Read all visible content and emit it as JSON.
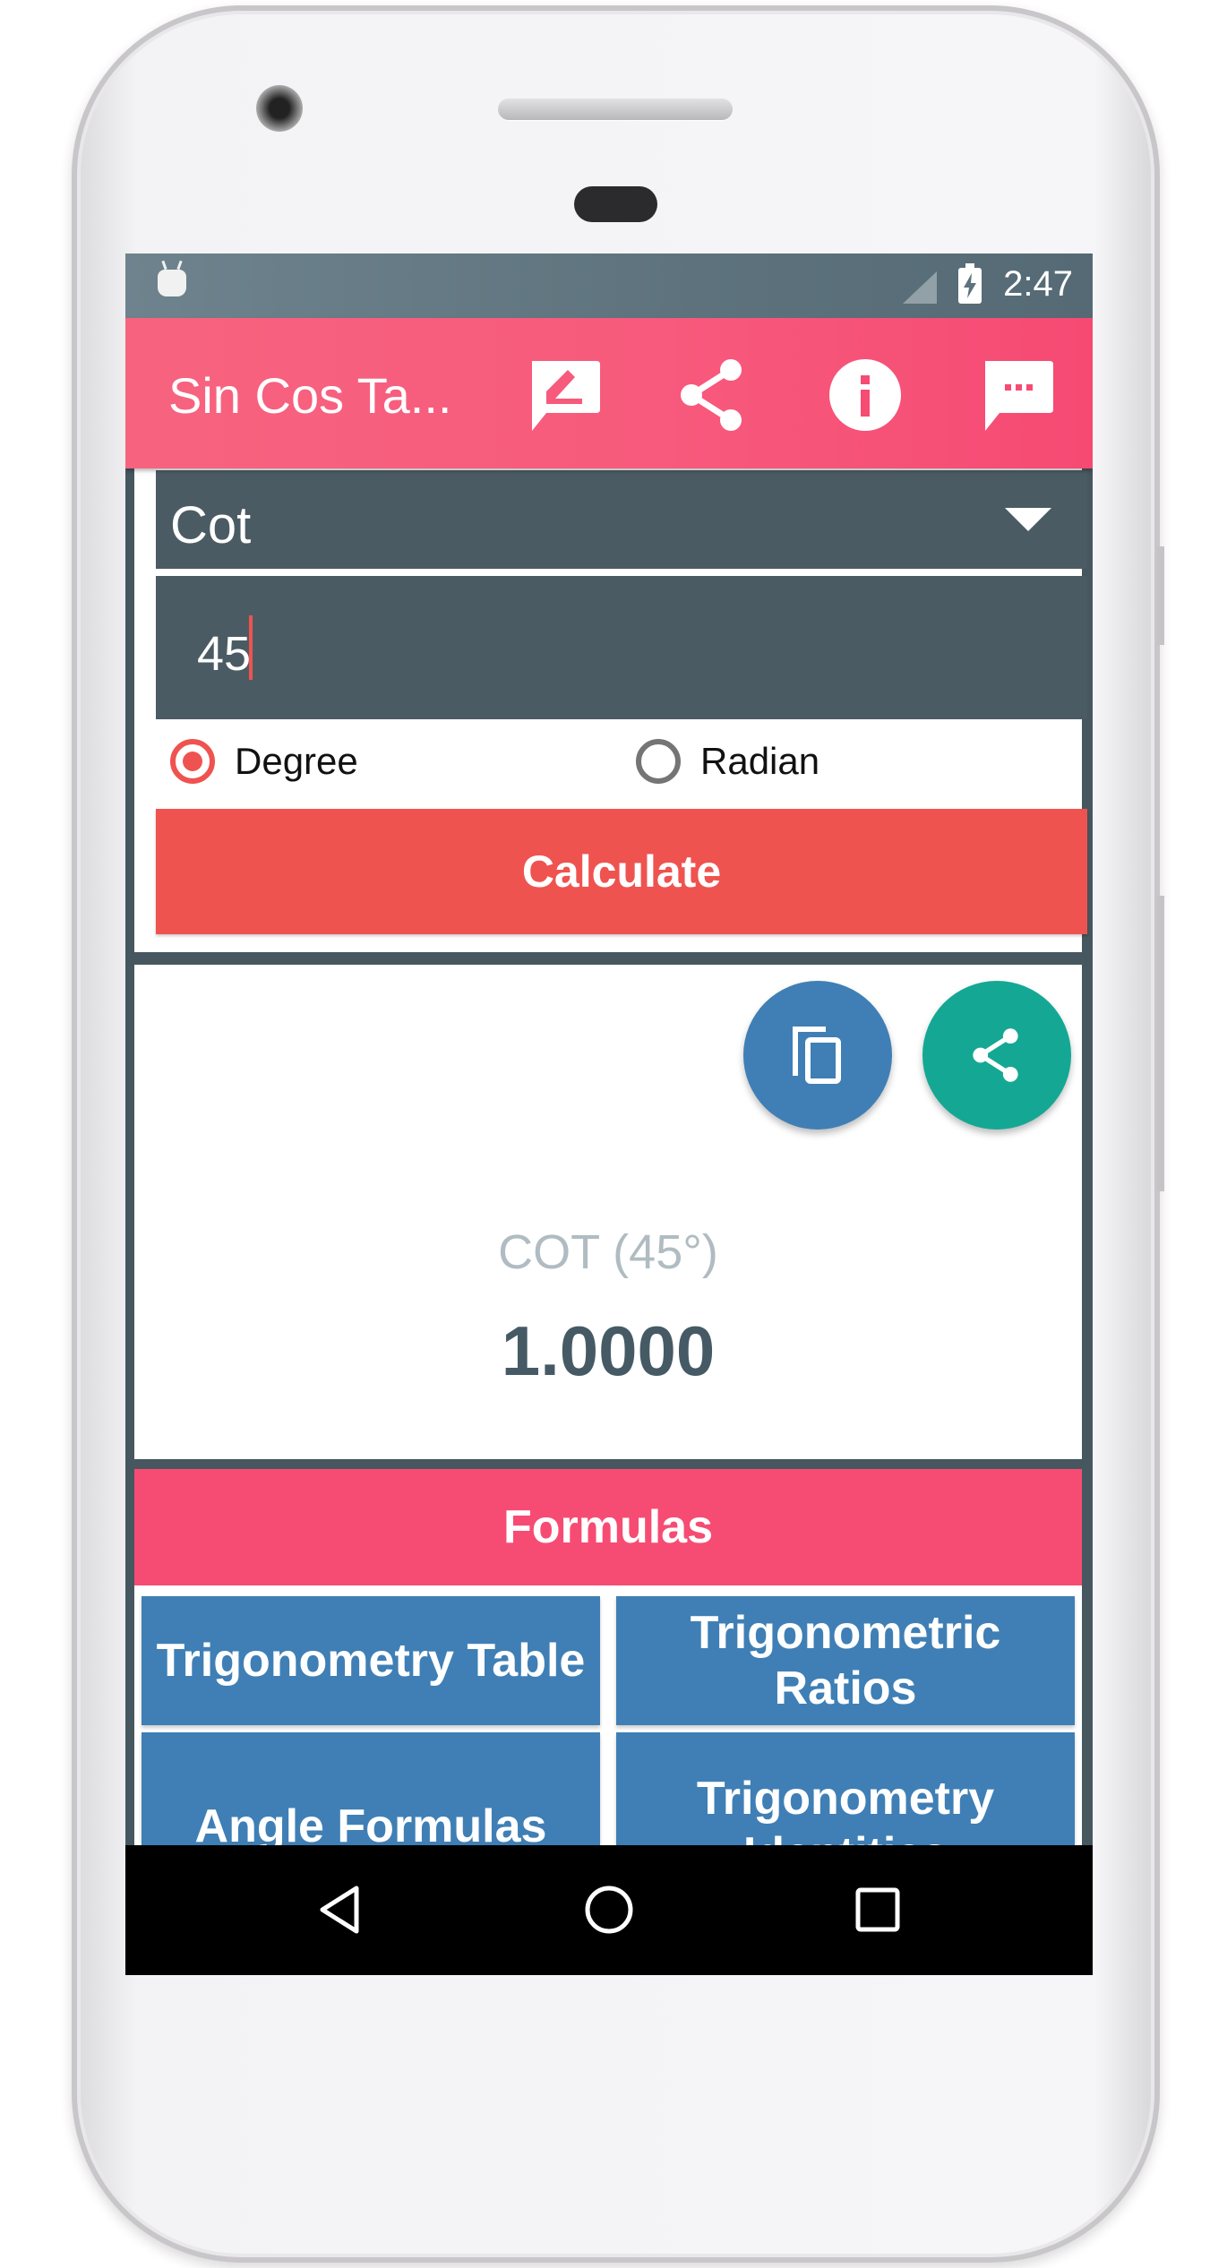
{
  "status_bar": {
    "time": "2:47",
    "icons": [
      "android-notification-icon",
      "signal-icon",
      "battery-charging-icon"
    ]
  },
  "app_bar": {
    "title": "Sin Cos Ta...",
    "actions": [
      {
        "name": "feedback-icon",
        "label": "Feedback"
      },
      {
        "name": "share-icon",
        "label": "Share"
      },
      {
        "name": "info-icon",
        "label": "Info"
      },
      {
        "name": "message-icon",
        "label": "Message"
      }
    ]
  },
  "calculator": {
    "function_select": {
      "value": "Cot"
    },
    "angle_input": {
      "value": "45"
    },
    "unit_options": [
      {
        "label": "Degree",
        "selected": true
      },
      {
        "label": "Radian",
        "selected": false
      }
    ],
    "calculate_label": "Calculate"
  },
  "result": {
    "label": "COT (45°)",
    "value": "1.0000",
    "copy_icon": "copy-icon",
    "share_icon": "share-icon"
  },
  "formulas": {
    "header": "Formulas",
    "buttons": [
      {
        "label": "Trigonometry Table"
      },
      {
        "label": "Trigonometric Ratios"
      },
      {
        "label": "Angle Formulas"
      },
      {
        "label": "Trigonometry Identities"
      }
    ]
  },
  "nav_bar": {
    "buttons": [
      "back-icon",
      "home-icon",
      "recents-icon"
    ]
  },
  "colors": {
    "primary": "#f64c73",
    "accent": "#ef5350",
    "dark": "#4b5b63",
    "blue": "#3f7fb5",
    "teal": "#14a894"
  }
}
